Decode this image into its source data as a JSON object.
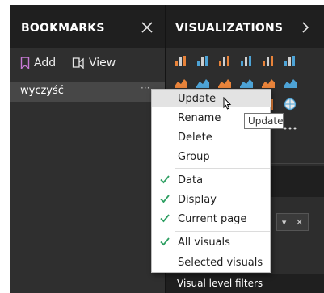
{
  "bookmarks_pane": {
    "title": "BOOKMARKS",
    "add_label": "Add",
    "view_label": "View",
    "items": [
      {
        "label": "wyczyść"
      }
    ],
    "more_label": "···"
  },
  "visualizations_pane": {
    "title": "VISUALIZATIONS",
    "dropdown_close": "✕",
    "footer_label": "Visual level filters",
    "icons": [
      "stacked-bar-icon",
      "stacked-column-icon",
      "clustered-bar-icon",
      "clustered-column-icon",
      "100-stacked-bar-icon",
      "100-stacked-column-icon",
      "line-chart-icon",
      "area-chart-icon",
      "stacked-area-icon",
      "line-column-icon",
      "line-clustered-column-icon",
      "ribbon-chart-icon",
      "waterfall-icon",
      "scatter-icon",
      "pie-icon",
      "donut-icon",
      "treemap-icon",
      "globe-map-icon",
      "filled-map-icon",
      "funnel-icon",
      "gauge-icon",
      "card-icon",
      "image-icon",
      "more-visuals-icon"
    ]
  },
  "context_menu": {
    "items": [
      {
        "label": "Update",
        "highlighted": true,
        "checked": false
      },
      {
        "label": "Rename",
        "checked": false
      },
      {
        "label": "Delete",
        "checked": false
      },
      {
        "label": "Group",
        "checked": false
      },
      {
        "label": "Data",
        "checked": true
      },
      {
        "label": "Display",
        "checked": true
      },
      {
        "label": "Current page",
        "checked": true
      },
      {
        "label": "All visuals",
        "checked": true
      },
      {
        "label": "Selected visuals",
        "checked": false
      }
    ]
  },
  "tooltip": {
    "text": "Update"
  },
  "colors": {
    "check_green": "#2e9f62",
    "menu_highlight": "#e3e3e3",
    "pane_dark": "#2f2f2f"
  }
}
